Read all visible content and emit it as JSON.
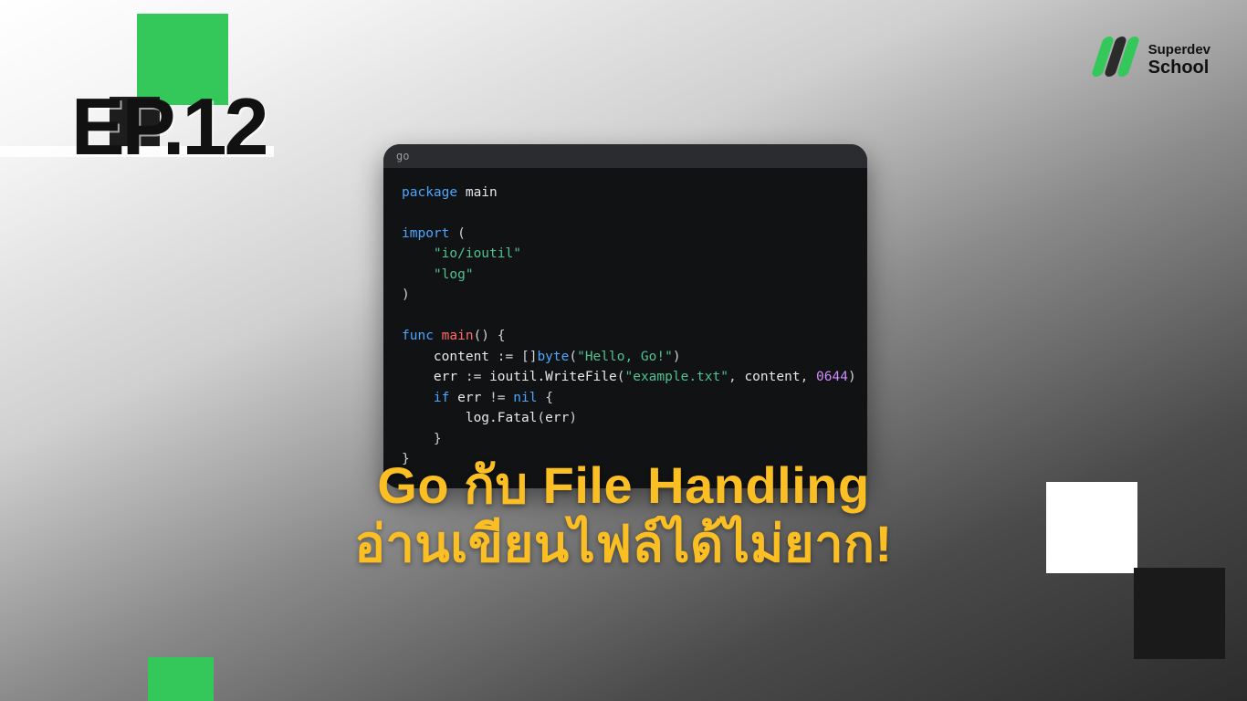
{
  "colors": {
    "accent_green": "#34c759",
    "accent_yellow": "#fbbf24",
    "code_bg": "#111214"
  },
  "brand": {
    "line1": "Superdev",
    "line2": "School"
  },
  "episode_label": "EP.12",
  "headline": {
    "line1": "Go กับ File Handling",
    "line2": "อ่านเขียนไฟล์ได้ไม่ยาก!"
  },
  "code": {
    "language_label": "go",
    "tokens": [
      [
        [
          "kw",
          "package"
        ],
        [
          "sp",
          " "
        ],
        [
          "id",
          "main"
        ]
      ],
      [],
      [
        [
          "kw",
          "import"
        ],
        [
          "sp",
          " "
        ],
        [
          "op",
          "("
        ]
      ],
      [
        [
          "sp",
          "    "
        ],
        [
          "str",
          "\"io/ioutil\""
        ]
      ],
      [
        [
          "sp",
          "    "
        ],
        [
          "str",
          "\"log\""
        ]
      ],
      [
        [
          "op",
          ")"
        ]
      ],
      [],
      [
        [
          "kw",
          "func"
        ],
        [
          "sp",
          " "
        ],
        [
          "fn",
          "main"
        ],
        [
          "op",
          "()"
        ],
        [
          "sp",
          " "
        ],
        [
          "op",
          "{"
        ]
      ],
      [
        [
          "sp",
          "    "
        ],
        [
          "id",
          "content"
        ],
        [
          "sp",
          " "
        ],
        [
          "op",
          ":="
        ],
        [
          "sp",
          " "
        ],
        [
          "op",
          "[]"
        ],
        [
          "type",
          "byte"
        ],
        [
          "op",
          "("
        ],
        [
          "str",
          "\"Hello, Go!\""
        ],
        [
          "op",
          ")"
        ]
      ],
      [
        [
          "sp",
          "    "
        ],
        [
          "id",
          "err"
        ],
        [
          "sp",
          " "
        ],
        [
          "op",
          ":="
        ],
        [
          "sp",
          " "
        ],
        [
          "id",
          "ioutil.WriteFile"
        ],
        [
          "op",
          "("
        ],
        [
          "str",
          "\"example.txt\""
        ],
        [
          "op",
          ", "
        ],
        [
          "id",
          "content"
        ],
        [
          "op",
          ", "
        ],
        [
          "num",
          "0644"
        ],
        [
          "op",
          ")"
        ]
      ],
      [
        [
          "sp",
          "    "
        ],
        [
          "kw",
          "if"
        ],
        [
          "sp",
          " "
        ],
        [
          "id",
          "err"
        ],
        [
          "sp",
          " "
        ],
        [
          "op",
          "!="
        ],
        [
          "sp",
          " "
        ],
        [
          "kw",
          "nil"
        ],
        [
          "sp",
          " "
        ],
        [
          "op",
          "{"
        ]
      ],
      [
        [
          "sp",
          "        "
        ],
        [
          "id",
          "log.Fatal"
        ],
        [
          "op",
          "("
        ],
        [
          "id",
          "err"
        ],
        [
          "op",
          ")"
        ]
      ],
      [
        [
          "sp",
          "    "
        ],
        [
          "op",
          "}"
        ]
      ],
      [
        [
          "op",
          "}"
        ]
      ]
    ]
  }
}
